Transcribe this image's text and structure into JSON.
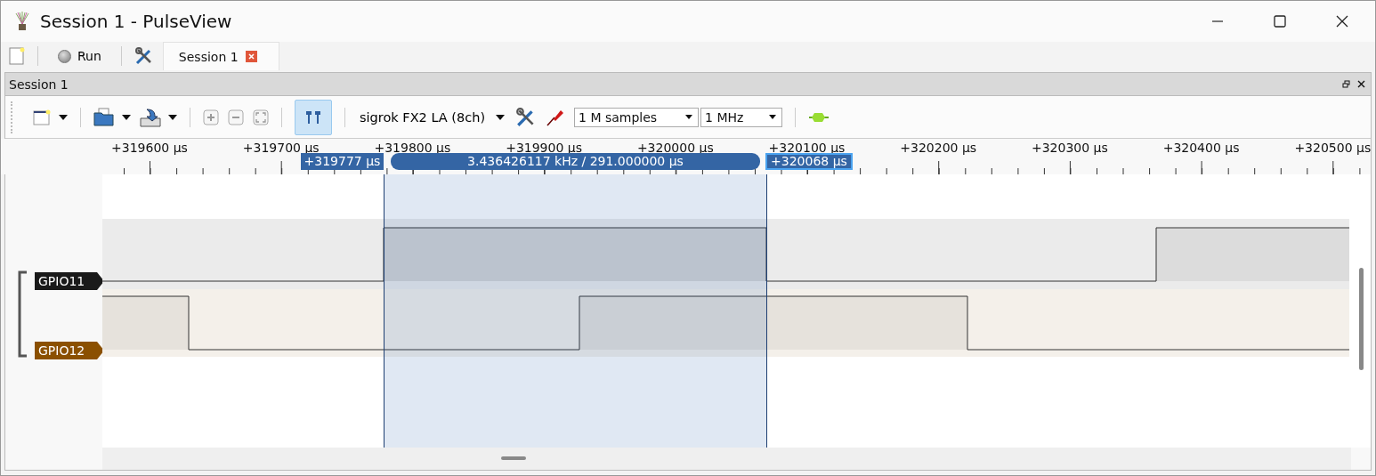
{
  "window": {
    "title": "Session 1 - PulseView"
  },
  "main_toolbar": {
    "run_label": "Run",
    "tabs": [
      {
        "label": "Session 1",
        "selected": true
      }
    ]
  },
  "dock": {
    "title": "Session 1"
  },
  "session_toolbar": {
    "device": "sigrok FX2 LA (8ch)",
    "sample_count": "1 M samples",
    "sample_rate": "1 MHz",
    "cursors_on": true
  },
  "ruler": {
    "ticks": [
      "+319600 µs",
      "+319700 µs",
      "+319800 µs",
      "+319900 µs",
      "+320000 µs",
      "+320100 µs",
      "+320200 µs",
      "+320300 µs",
      "+320400 µs",
      "+320500 µs"
    ],
    "cursor_left": "+319777 µs",
    "measurement": "3.436426117 kHz / 291.000000 µs",
    "cursor_right": "+320068 µs"
  },
  "channels": [
    {
      "name": "GPIO11",
      "color": "#1a1a1a"
    },
    {
      "name": "GPIO12",
      "color": "#8b5000"
    }
  ]
}
